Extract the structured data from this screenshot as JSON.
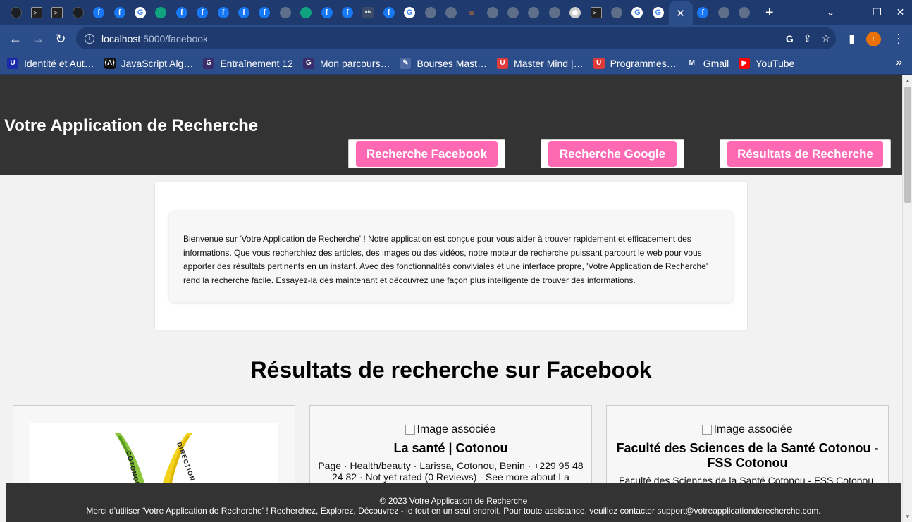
{
  "browser": {
    "tab_icons": [
      "github-icon",
      "terminal-icon",
      "terminal-icon",
      "github-icon",
      "facebook-icon",
      "facebook-icon",
      "google-icon",
      "chatgpt-icon",
      "facebook-icon",
      "facebook-icon",
      "facebook-icon",
      "facebook-icon",
      "facebook-icon",
      "globe-icon",
      "chatgpt-icon",
      "facebook-icon",
      "facebook-icon",
      "tds-icon",
      "facebook-icon",
      "google-icon",
      "globe-icon",
      "globe-icon",
      "stackoverflow-icon",
      "globe-icon",
      "globe-icon",
      "globe-icon",
      "globe-icon",
      "chrome-icon",
      "terminal-icon",
      "globe-icon",
      "google-icon",
      "google-photos-icon",
      "facebook-icon",
      "globe-icon",
      "globe-icon"
    ],
    "tab_fav_text": {
      "fb": "f",
      "g": "G",
      "tds": "tds",
      "term": ">_",
      "so": "≡"
    },
    "active_tab_close": "✕",
    "new_tab": "+",
    "window_controls": {
      "list": "⌄",
      "minimize": "—",
      "restore": "❐",
      "close": "✕"
    },
    "nav": {
      "back": "←",
      "forward": "→",
      "reload": "↻"
    },
    "url_host": "localhost",
    "url_path": ":5000/facebook",
    "omni_icons": {
      "google": "G",
      "share": "⇪",
      "star": "☆"
    },
    "profile_initial": "r",
    "sidebar_icon": "▮",
    "menu_icon": "⋮",
    "bookmarks": [
      {
        "label": "Identité et Aut…",
        "icon": "U",
        "color": "#1a2aa8"
      },
      {
        "label": "JavaScript Alg…",
        "icon": "⟨A⟩",
        "color": "#111111"
      },
      {
        "label": "Entraînement 12",
        "icon": "G",
        "color": "#3a2d6b"
      },
      {
        "label": "Mon parcours…",
        "icon": "G",
        "color": "#3a2d6b"
      },
      {
        "label": "Bourses Mast…",
        "icon": "✎",
        "color": "#4d6aa3"
      },
      {
        "label": "Master Mind |…",
        "icon": "U",
        "color": "#e03b3b"
      },
      {
        "label": "Programmes…",
        "icon": "U",
        "color": "#e03b3b"
      },
      {
        "label": "Gmail",
        "icon": "M",
        "color": "#2b4d8a"
      },
      {
        "label": "YouTube",
        "icon": "▶",
        "color": "#ff0000"
      }
    ],
    "bookmarks_more": "»"
  },
  "header": {
    "title": "Votre Application de Recherche",
    "nav": {
      "facebook": "Recherche Facebook",
      "google": "Recherche Google",
      "results": "Résultats de Recherche"
    }
  },
  "intro": {
    "text": "Bienvenue sur 'Votre Application de Recherche' ! Notre application est conçue pour vous aider à trouver rapidement et efficacement des informations. Que vous recherchiez des articles, des images ou des vidéos, notre moteur de recherche puissant parcourt le web pour vous apporter des résultats pertinents en un instant. Avec des fonctionnalités conviviales et une interface propre, 'Votre Application de Recherche' rend la recherche facile. Essayez-la dès maintenant et découvrez une façon plus intelligente de trouver des informations."
  },
  "results": {
    "title": "Résultats de recherche sur Facebook",
    "items": [
      {
        "title": "",
        "image_alt": "",
        "description": "",
        "logo_text": "COTONOU · DIRECTION D"
      },
      {
        "image_alt": "Image associée",
        "title": "La santé | Cotonou",
        "description": "Page · Health/beauty · Larissa, Cotonou, Benin · +229 95 48 24 82 · Not yet rated (0 Reviews) · See more about La"
      },
      {
        "image_alt": "Image associée",
        "title": "Faculté des Sciences de la Santé Cotonou - FSS Cotonou",
        "description": "Faculté des Sciences de la Santé Cotonou - FSS Cotonou."
      }
    ]
  },
  "footer": {
    "copyright": "© 2023 Votre Application de Recherche",
    "message": "Merci d'utiliser 'Votre Application de Recherche' ! Recherchez, Explorez, Découvrez - le tout en un seul endroit. Pour toute assistance, veuillez contacter support@votreapplicationderecherche.com."
  },
  "colors": {
    "header_bg": "#333333",
    "nav_button": "#ff69b4",
    "browser_frame": "#2b4d8a"
  }
}
